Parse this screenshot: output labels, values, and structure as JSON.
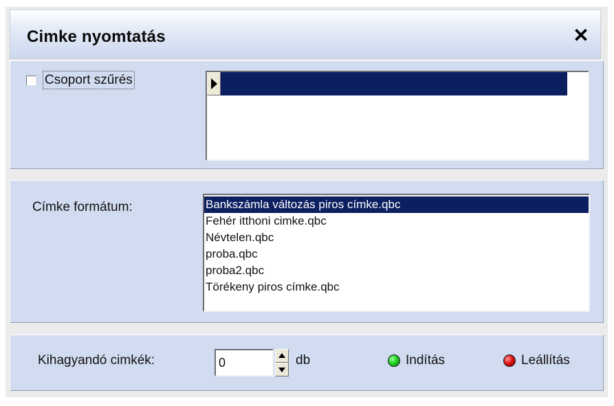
{
  "window": {
    "title": "Cimke nyomtatás",
    "close_label": "✕"
  },
  "group_filter": {
    "checkbox_label": "Csoport szűrés",
    "checked": false,
    "grid_rows": [
      ""
    ]
  },
  "label_format": {
    "label": "Címke formátum:",
    "items": [
      "Bankszámla változás piros címke.qbc",
      "Fehér itthoni cimke.qbc",
      "Névtelen.qbc",
      "proba.qbc",
      "proba2.qbc",
      "Törékeny piros címke.qbc"
    ],
    "selected_index": 0
  },
  "controls": {
    "skip_label": "Kihagyandó cimkék:",
    "skip_value": "0",
    "unit": "db",
    "start_label": "Indítás",
    "stop_label": "Leállítás"
  },
  "colors": {
    "panel_bg": "#d2dcf1",
    "selection": "#0c1f61",
    "start_indicator": "#1fd11f",
    "stop_indicator": "#e01010"
  }
}
